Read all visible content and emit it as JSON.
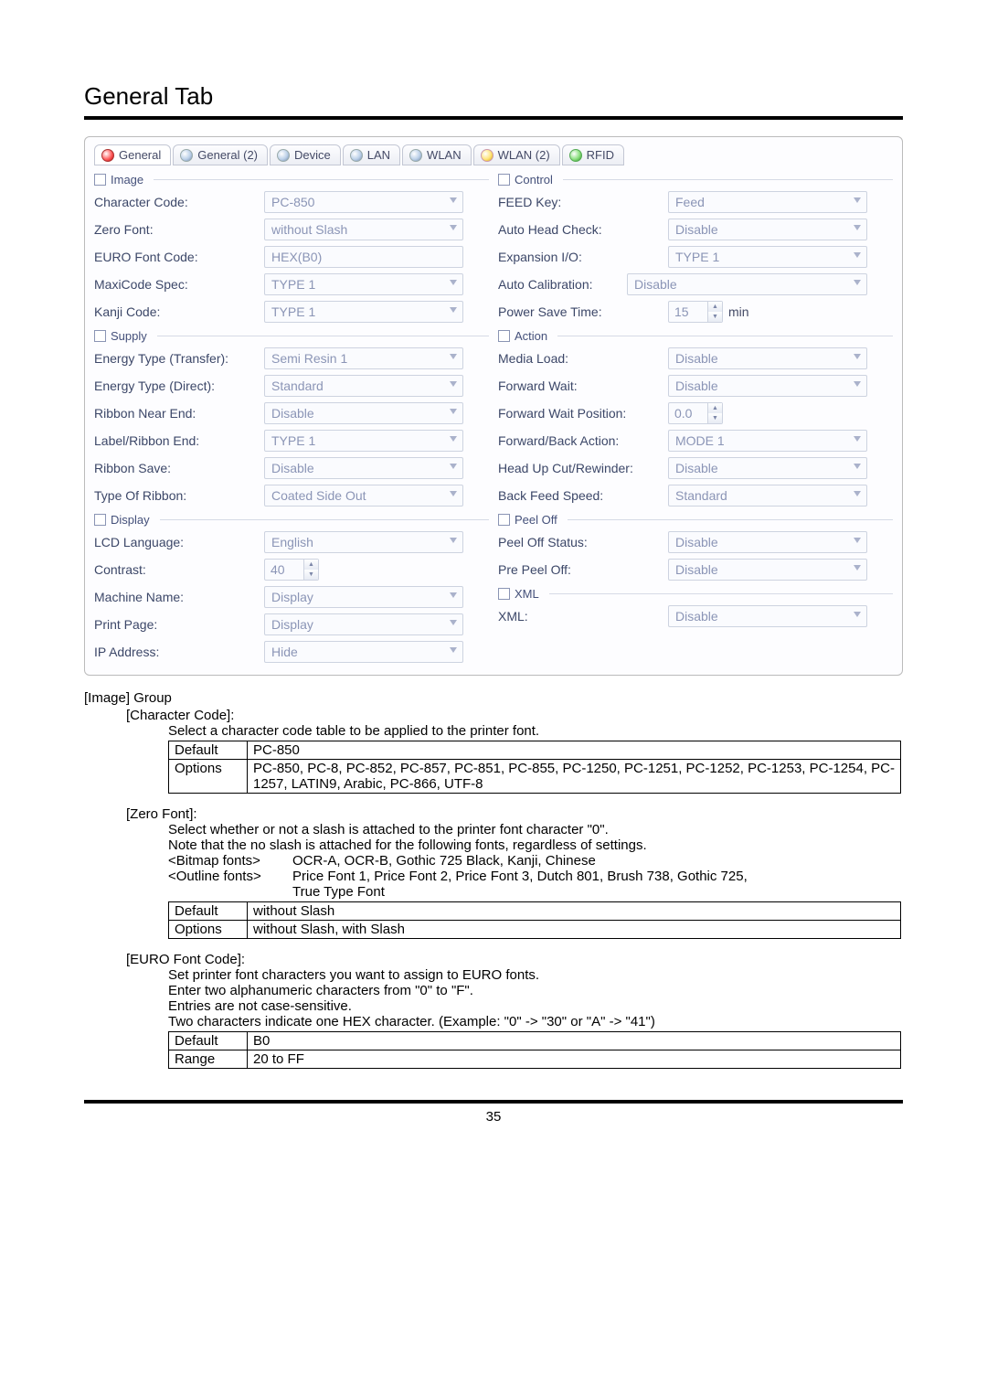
{
  "title": "General Tab",
  "tabs": [
    {
      "label": "General"
    },
    {
      "label": "General (2)"
    },
    {
      "label": "Device"
    },
    {
      "label": "LAN"
    },
    {
      "label": "WLAN"
    },
    {
      "label": "WLAN (2)"
    },
    {
      "label": "RFID"
    }
  ],
  "groups": {
    "image": {
      "title": "Image",
      "rows": [
        {
          "label": "Character Code:",
          "value": "PC-850"
        },
        {
          "label": "Zero Font:",
          "value": "without Slash"
        },
        {
          "label": "EURO Font Code:",
          "value": "HEX(B0)"
        },
        {
          "label": "MaxiCode Spec:",
          "value": "TYPE 1"
        },
        {
          "label": "Kanji Code:",
          "value": "TYPE 1"
        }
      ]
    },
    "supply": {
      "title": "Supply",
      "rows": [
        {
          "label": "Energy Type (Transfer):",
          "value": "Semi Resin 1"
        },
        {
          "label": "Energy Type (Direct):",
          "value": "Standard"
        },
        {
          "label": "Ribbon Near End:",
          "value": "Disable"
        },
        {
          "label": "Label/Ribbon End:",
          "value": "TYPE 1"
        },
        {
          "label": "Ribbon Save:",
          "value": "Disable"
        },
        {
          "label": "Type Of Ribbon:",
          "value": "Coated Side Out"
        }
      ]
    },
    "display": {
      "title": "Display",
      "rows": [
        {
          "label": "LCD Language:",
          "value": "English"
        },
        {
          "label": "Contrast:",
          "value": "40",
          "spinner": true
        },
        {
          "label": "Machine Name:",
          "value": "Display"
        },
        {
          "label": "Print Page:",
          "value": "Display"
        },
        {
          "label": "IP Address:",
          "value": "Hide"
        }
      ]
    },
    "control": {
      "title": "Control",
      "rows": [
        {
          "label": "FEED Key:",
          "value": "Feed"
        },
        {
          "label": "Auto Head Check:",
          "value": "Disable"
        },
        {
          "label": "Expansion I/O:",
          "value": "TYPE 1"
        },
        {
          "label": "Auto Calibration:",
          "value": "Disable"
        },
        {
          "label": "Power Save Time:",
          "value": "15",
          "spinner": true,
          "suffix": "min"
        }
      ]
    },
    "action": {
      "title": "Action",
      "rows": [
        {
          "label": "Media Load:",
          "value": "Disable"
        },
        {
          "label": "Forward Wait:",
          "value": "Disable"
        },
        {
          "label": "Forward Wait Position:",
          "value": "0.0",
          "spinner": true
        },
        {
          "label": "Forward/Back Action:",
          "value": "MODE 1"
        },
        {
          "label": "Head Up Cut/Rewinder:",
          "value": "Disable"
        },
        {
          "label": "Back Feed Speed:",
          "value": "Standard"
        }
      ]
    },
    "peeloff": {
      "title": "Peel Off",
      "rows": [
        {
          "label": "Peel Off Status:",
          "value": "Disable"
        },
        {
          "label": "Pre Peel Off:",
          "value": "Disable"
        }
      ]
    },
    "xml": {
      "title": "XML",
      "rows": [
        {
          "label": "XML:",
          "value": "Disable"
        }
      ]
    }
  },
  "doc": {
    "imageGroupHeading": "[Image] Group",
    "characterCode": {
      "heading": "[Character Code]:",
      "desc": "Select a character code table to be applied to the printer font.",
      "table": {
        "defaultLabel": "Default",
        "defaultValue": "PC-850",
        "optionsLabel": "Options",
        "optionsValue": "PC-850, PC-8, PC-852, PC-857, PC-851, PC-855, PC-1250, PC-1251, PC-1252, PC-1253, PC-1254, PC-1257, LATIN9, Arabic, PC-866, UTF-8"
      }
    },
    "zeroFont": {
      "heading": "[Zero Font]:",
      "line1": "Select whether or not a slash is attached to the printer font character \"0\".",
      "line2": "Note that the no slash is attached for the following fonts, regardless of settings.",
      "bitmapLabel": "<Bitmap fonts>",
      "bitmapValue": "OCR-A, OCR-B, Gothic 725 Black, Kanji, Chinese",
      "outlineLabel": "<Outline fonts>",
      "outlineValue1": "Price Font 1, Price Font 2, Price Font 3, Dutch 801, Brush 738, Gothic 725,",
      "outlineValue2": "True Type Font",
      "table": {
        "defaultLabel": "Default",
        "defaultValue": "without Slash",
        "optionsLabel": "Options",
        "optionsValue": "without Slash, with Slash"
      }
    },
    "euroFont": {
      "heading": "[EURO Font Code]:",
      "line1": "Set printer font characters you want to assign to EURO fonts.",
      "line2": "Enter two alphanumeric characters from \"0\" to \"F\".",
      "line3": "Entries are not case-sensitive.",
      "line4": "Two characters indicate one HEX character.    (Example: \"0\" -> \"30\" or \"A\" -> \"41\")",
      "table": {
        "defaultLabel": "Default",
        "defaultValue": "B0",
        "rangeLabel": "Range",
        "rangeValue": "20 to FF"
      }
    }
  },
  "pageNumber": "35"
}
